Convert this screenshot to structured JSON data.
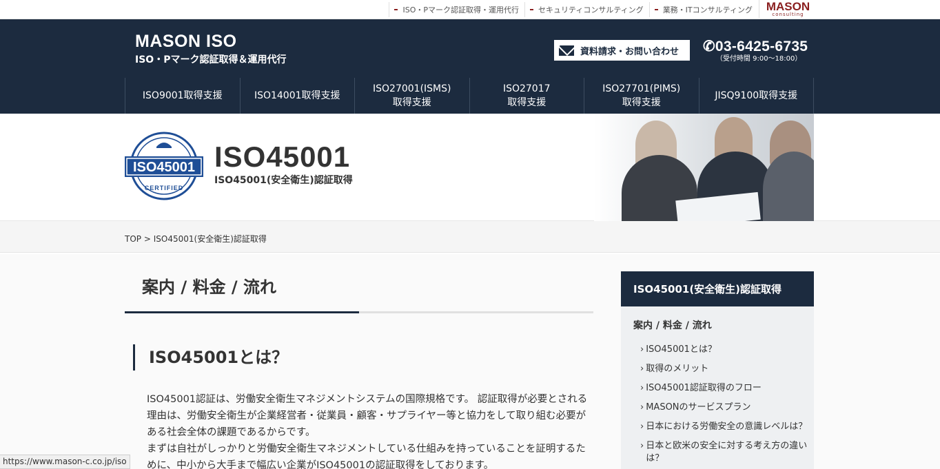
{
  "topbar": {
    "links": [
      "ISO・Pマーク認証取得・運用代行",
      "セキュリティコンサルティング",
      "業務・ITコンサルティング"
    ],
    "logo": "MASON",
    "logo_sub": "consulting"
  },
  "header": {
    "brand_name": "MASON ISO",
    "brand_tag": "ISO・Pマーク認証取得＆運用代行",
    "contact_label": "資料請求・お問い合わせ",
    "phone": "03-6425-6735",
    "hours": "（受付時間 9:00〜18:00）",
    "nav": [
      {
        "line1": "ISO9001取得支援",
        "line2": ""
      },
      {
        "line1": "ISO14001取得支援",
        "line2": ""
      },
      {
        "line1": "ISO27001(ISMS)",
        "line2": "取得支援"
      },
      {
        "line1": "ISO27017",
        "line2": "取得支援"
      },
      {
        "line1": "ISO27701(PIMS)",
        "line2": "取得支援"
      },
      {
        "line1": "JISQ9100取得支援",
        "line2": ""
      }
    ]
  },
  "hero": {
    "badge_text": "ISO45001",
    "badge_sub": "CERTIFIED",
    "title": "ISO45001",
    "subtitle": "ISO45001(安全衛生)認証取得"
  },
  "breadcrumb": {
    "home": "TOP",
    "separator": ">",
    "current": "ISO45001(安全衛生)認証取得"
  },
  "main": {
    "section_title": "案内 / 料金 / 流れ",
    "h2": "ISO45001とは？",
    "paragraph1": "ISO45001認証は、労働安全衛生マネジメントシステムの国際規格です。 認証取得が必要とされる理由は、労働安全衛生が企業経営者・従業員・顧客・サプライヤー等と協力をして取り組む必要がある社会全体の課題であるからです。",
    "paragraph2": "まずは自社がしっかりと労働安全衛生マネジメントしている仕組みを持っていることを証明するために、中小から大手まで幅広い企業がISO45001の認証取得をしております。"
  },
  "sidebar": {
    "heading": "ISO45001(安全衛生)認証取得",
    "subheading": "案内 / 料金 / 流れ",
    "items": [
      "ISO45001とは？",
      "取得のメリット",
      "ISO45001認証取得のフロー",
      "MASONのサービスプラン",
      "日本における労働安全の意識レベルは？",
      "日本と欧米の安全に対する考え方の違いは？"
    ]
  },
  "status_url": "https://www.mason-c.co.jp/iso",
  "colors": {
    "navy": "#1c2b3f",
    "brand_red": "#8a1f1f",
    "badge_blue": "#1f4e96"
  }
}
